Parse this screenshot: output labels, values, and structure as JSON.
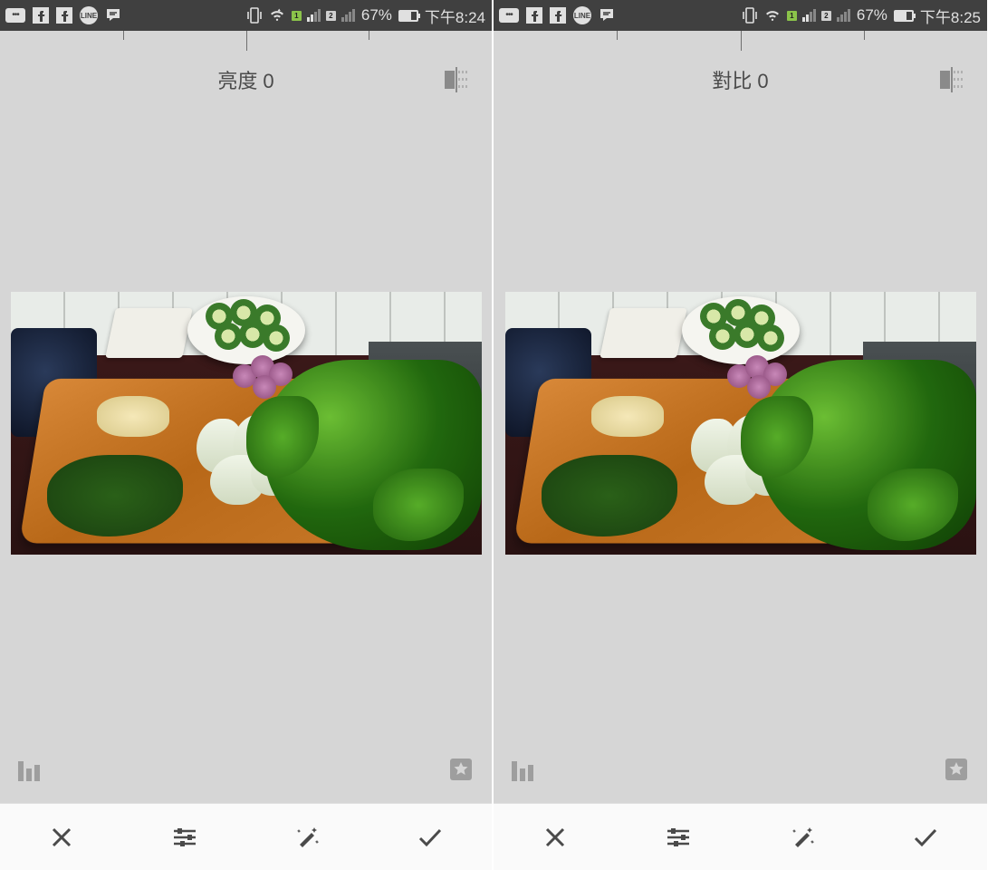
{
  "screens": [
    {
      "time": "下午8:24",
      "battery": "67%",
      "adjust_label": "亮度 0"
    },
    {
      "time": "下午8:25",
      "battery": "67%",
      "adjust_label": "對比 0"
    }
  ],
  "status_icons": {
    "line_app": "LINE",
    "sim1": "1",
    "sim2": "2"
  },
  "toolbar": {
    "cancel": "cancel",
    "adjust": "adjust",
    "auto": "auto-fix",
    "confirm": "confirm"
  },
  "overlay": {
    "histogram": "histogram",
    "favorite": "favorite"
  },
  "compare": "compare"
}
